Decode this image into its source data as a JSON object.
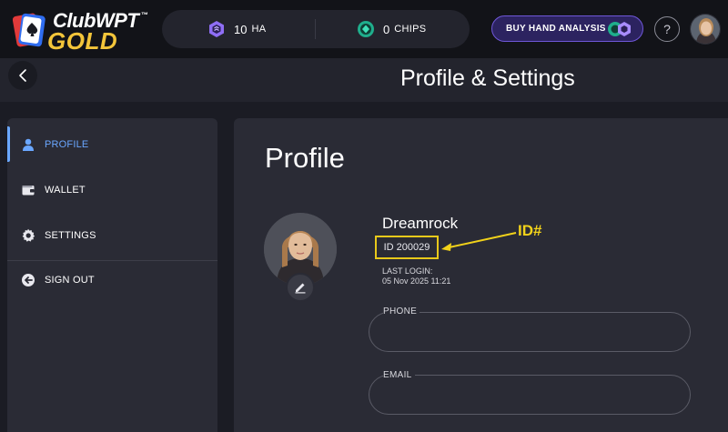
{
  "brand": {
    "club": "ClubWPT",
    "tm": "™",
    "gold": "GOLD"
  },
  "balances": {
    "ha": {
      "value": "10",
      "unit": "HA",
      "icon": "ha-token-icon"
    },
    "chips": {
      "value": "0",
      "unit": "CHIPS",
      "icon": "chips-token-icon"
    }
  },
  "header": {
    "buy_label": "BUY HAND ANALYSIS",
    "help_label": "?",
    "title": "Profile & Settings"
  },
  "sidebar": {
    "items": [
      {
        "label": "PROFILE",
        "icon": "user-icon",
        "active": true
      },
      {
        "label": "WALLET",
        "icon": "wallet-icon",
        "active": false
      },
      {
        "label": "SETTINGS",
        "icon": "gear-icon",
        "active": false
      },
      {
        "label": "SIGN OUT",
        "icon": "sign-out-icon",
        "active": false
      }
    ]
  },
  "profile": {
    "title": "Profile",
    "username": "Dreamrock",
    "user_id": "ID 200029",
    "annotation": "ID#",
    "last_login_label": "LAST LOGIN:",
    "last_login_value": "05 Nov 2025 11:21",
    "phone_label": "PHONE",
    "phone_value": "",
    "email_label": "EMAIL",
    "email_value": ""
  },
  "colors": {
    "accent_blue": "#6aa7ff",
    "gold": "#f3c53a",
    "annotation_yellow": "#f1d21a",
    "buy_button_border": "#6f57d8"
  }
}
